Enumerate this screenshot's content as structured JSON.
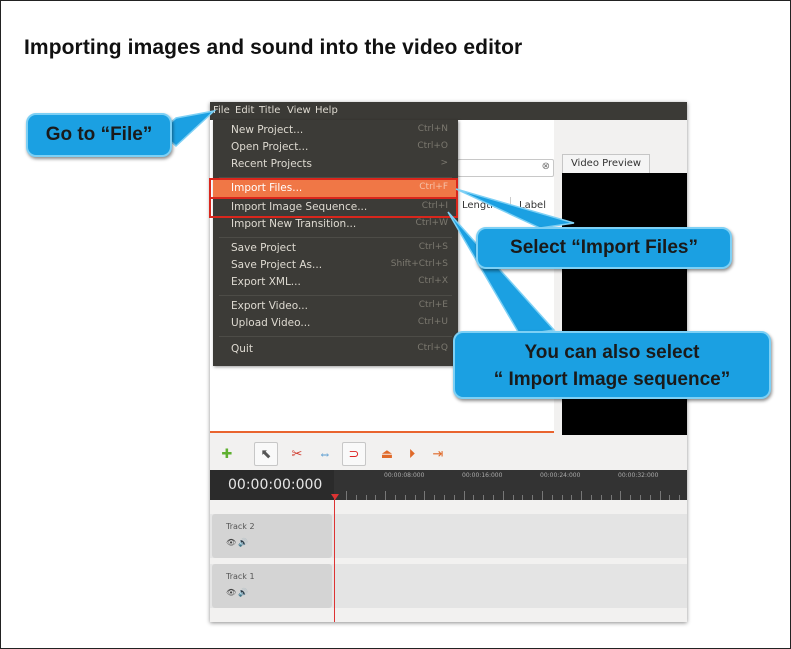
{
  "page_title": "Importing images and sound into the video editor",
  "menubar": [
    "File",
    "Edit",
    "Title",
    "View",
    "Help"
  ],
  "file_menu": {
    "items": [
      {
        "label": "New Project...",
        "shortcut": "Ctrl+N"
      },
      {
        "label": "Open Project...",
        "shortcut": "Ctrl+O"
      },
      {
        "label": "Recent Projects",
        "shortcut": ">"
      },
      {
        "label": "Import Files...",
        "shortcut": "Ctrl+F"
      },
      {
        "label": "Import Image Sequence...",
        "shortcut": "Ctrl+I"
      },
      {
        "label": "Import New Transition...",
        "shortcut": "Ctrl+W"
      },
      {
        "label": "Save Project",
        "shortcut": "Ctrl+S"
      },
      {
        "label": "Save Project As...",
        "shortcut": "Shift+Ctrl+S"
      },
      {
        "label": "Export XML...",
        "shortcut": "Ctrl+X"
      },
      {
        "label": "Export Video...",
        "shortcut": "Ctrl+E"
      },
      {
        "label": "Upload Video...",
        "shortcut": "Ctrl+U"
      },
      {
        "label": "Quit",
        "shortcut": "Ctrl+Q"
      }
    ],
    "highlighted": "Import Files..."
  },
  "project_panel": {
    "columns": [
      "Length",
      "Label"
    ],
    "search_clear_icon": "clear-icon"
  },
  "preview": {
    "tab_label": "Video Preview"
  },
  "timeline": {
    "timecode": "00:00:00:000",
    "ruler_labels": [
      "00:00:08:000",
      "00:00:16:000",
      "00:00:24:000",
      "00:00:32:000"
    ],
    "tracks": [
      {
        "name": "Track 2",
        "icons": "👁 🔊"
      },
      {
        "name": "Track 1",
        "icons": "👁 🔊"
      }
    ]
  },
  "toolbar_icons": [
    "add-icon",
    "select-arrow-icon",
    "razor-icon",
    "arrange-icon",
    "snap-magnet-icon",
    "import-icon",
    "next-marker-icon",
    "previous-marker-icon"
  ],
  "callouts": {
    "go_file": "Go to “File”",
    "select_import": "Select “Import Files”",
    "also_select_line1": "You can also select",
    "also_select_line2": "“ Import Image sequence”"
  },
  "colors": {
    "menu_bg": "#3c3b37",
    "menu_highlight": "#f07746",
    "callout_bg": "#1ba0e2",
    "highlight_box": "#d9261c"
  }
}
